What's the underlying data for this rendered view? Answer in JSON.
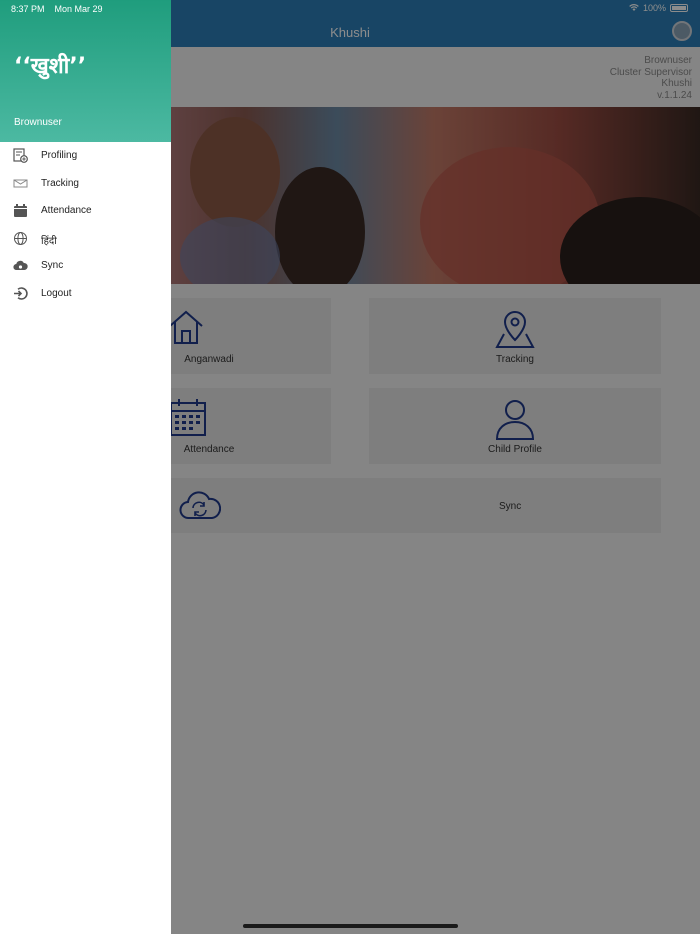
{
  "status_bar": {
    "time": "8:37 PM",
    "date": "Mon Mar 29",
    "battery": "100%"
  },
  "app": {
    "title": "Khushi",
    "user": {
      "name": "Brownuser",
      "role": "Cluster Supervisor",
      "app_name": "Khushi",
      "version": "v.1.1.24"
    },
    "tiles": {
      "anganwadi": "Anganwadi",
      "tracking": "Tracking",
      "attendance": "Attendance",
      "child_profile": "Child Profile",
      "sync": "Sync"
    }
  },
  "drawer": {
    "logo": "‘‘खुशी’’",
    "username": "Brownuser",
    "items": [
      {
        "label": "Profiling",
        "icon": "profiling-icon"
      },
      {
        "label": "Tracking",
        "icon": "tracking-icon"
      },
      {
        "label": "Attendance",
        "icon": "attendance-icon"
      },
      {
        "label": "हिंदी",
        "icon": "globe-icon"
      },
      {
        "label": "Sync",
        "icon": "cloud-icon"
      },
      {
        "label": "Logout",
        "icon": "logout-icon"
      }
    ]
  },
  "colors": {
    "navbar": "#2d7fb8",
    "drawer_header": "#1f9d7d",
    "icon_blue": "#1f3a8a"
  }
}
